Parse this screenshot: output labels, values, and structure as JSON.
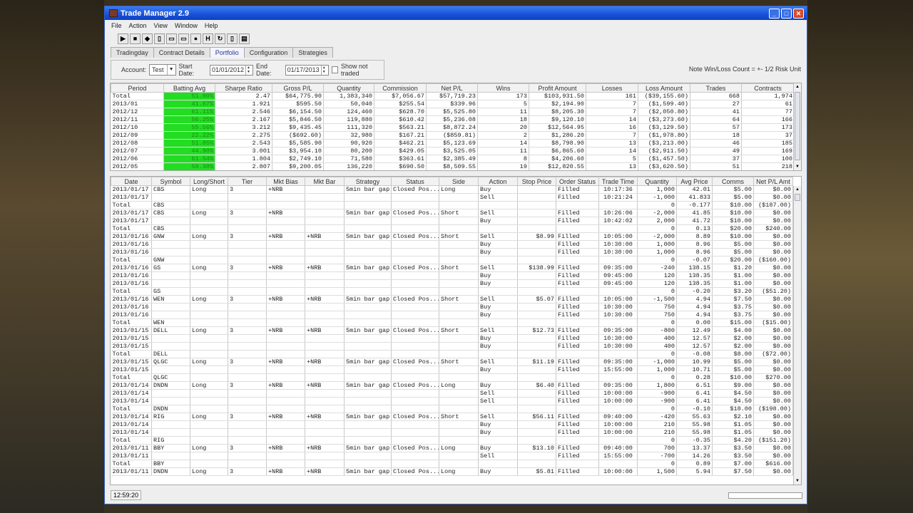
{
  "window": {
    "title": "Trade Manager 2.9"
  },
  "menu": [
    "File",
    "Action",
    "View",
    "Window",
    "Help"
  ],
  "toolbar": [
    {
      "icon": "open-icon",
      "glyph": "▶"
    },
    {
      "icon": "save-icon",
      "glyph": "■"
    },
    {
      "icon": "book-icon",
      "glyph": "◆"
    },
    {
      "icon": "doc-icon",
      "glyph": "▯"
    },
    {
      "icon": "copy-icon",
      "glyph": "▭"
    },
    {
      "icon": "paste-icon",
      "glyph": "▭"
    },
    {
      "icon": "stop-icon",
      "glyph": "●"
    },
    {
      "icon": "h-icon",
      "glyph": "H"
    },
    {
      "icon": "refresh-icon",
      "glyph": "↻"
    },
    {
      "icon": "clipboard-icon",
      "glyph": "▯"
    },
    {
      "icon": "report-icon",
      "glyph": "▤"
    }
  ],
  "tabs": [
    "Tradingday",
    "Contract Details",
    "Portfolio",
    "Configuration",
    "Strategies"
  ],
  "filter": {
    "account_label": "Account:",
    "account": "Test",
    "start_label": "Start Date:",
    "start": "01/01/2012",
    "end_label": "End Date:",
    "end": "01/17/2013",
    "show_not_traded": "Show not traded",
    "note": "Note Win/Loss Count = +- 1/2 Risk Unit"
  },
  "summary": {
    "columns": [
      "Period",
      "Batting Avg",
      "Sharpe Ratio",
      "Gross P/L",
      "Quantity",
      "Commission",
      "Net P/L",
      "Wins",
      "Profit Amount",
      "Losses",
      "Loss Amount",
      "Trades",
      "Contracts"
    ],
    "rows": [
      [
        "Total",
        "51.80%",
        "2.47",
        "$64,775.90",
        "1,383,340",
        "$7,056.67",
        "$57,719.23",
        "173",
        "$103,931.50",
        "161",
        "($39,155.60)",
        "668",
        "1,974"
      ],
      [
        "2013/01",
        "41.67%",
        "1.921",
        "$595.50",
        "50,040",
        "$255.54",
        "$339.96",
        "5",
        "$2,194.90",
        "7",
        "($1,599.40)",
        "27",
        "61"
      ],
      [
        "2012/12",
        "61.11%",
        "2.546",
        "$6,154.50",
        "124,460",
        "$628.70",
        "$5,525.80",
        "11",
        "$8,205.30",
        "7",
        "($2,050.80)",
        "41",
        "77"
      ],
      [
        "2012/11",
        "56.25%",
        "2.167",
        "$5,846.50",
        "119,880",
        "$610.42",
        "$5,236.08",
        "18",
        "$9,120.10",
        "14",
        "($3,273.60)",
        "64",
        "166"
      ],
      [
        "2012/10",
        "55.56%",
        "3.212",
        "$9,435.45",
        "111,320",
        "$563.21",
        "$8,872.24",
        "20",
        "$12,564.95",
        "16",
        "($3,129.50)",
        "57",
        "173"
      ],
      [
        "2012/09",
        "22.22%",
        "2.275",
        "($692.60)",
        "32,980",
        "$167.21",
        "($859.81)",
        "2",
        "$1,286.20",
        "7",
        "($1,978.80)",
        "18",
        "37"
      ],
      [
        "2012/08",
        "51.85%",
        "2.543",
        "$5,585.90",
        "90,920",
        "$462.21",
        "$5,123.69",
        "14",
        "$8,798.90",
        "13",
        "($3,213.00)",
        "46",
        "185"
      ],
      [
        "2012/07",
        "44.90%",
        "3.001",
        "$3,954.10",
        "80,200",
        "$429.05",
        "$3,525.05",
        "11",
        "$6,865.60",
        "14",
        "($2,911.50)",
        "49",
        "169"
      ],
      [
        "2012/06",
        "61.54%",
        "1.804",
        "$2,749.10",
        "71,580",
        "$363.61",
        "$2,385.49",
        "8",
        "$4,206.60",
        "5",
        "($1,457.50)",
        "37",
        "100"
      ],
      [
        "2012/05",
        "59.38%",
        "2.807",
        "$9,200.05",
        "136,220",
        "$690.50",
        "$8,509.55",
        "19",
        "$12,820.55",
        "13",
        "($3,620.50)",
        "51",
        "218"
      ]
    ]
  },
  "trades": {
    "columns": [
      "Date",
      "Symbol",
      "Long/Short",
      "Tier",
      "Mkt Bias",
      "Mkt Bar",
      "Strategy",
      "Status",
      "Side",
      "Action",
      "Stop Price",
      "Order Status",
      "Trade Time",
      "Quantity",
      "Avg Price",
      "Comms",
      "Net P/L Amt"
    ],
    "rows": [
      [
        "2013/01/17",
        "CBS",
        "Long",
        "3",
        "+NRB",
        "",
        "5min bar gap",
        "Closed Pos...",
        "Long",
        "Buy",
        "",
        "Filled",
        "10:17:36",
        "1,000",
        "42.01",
        "$5.00",
        "$0.00"
      ],
      [
        "2013/01/17",
        "",
        "",
        "",
        "",
        "",
        "",
        "",
        "",
        "Sell",
        "",
        "Filled",
        "10:21:24",
        "-1,000",
        "41.833",
        "$5.00",
        "$0.00"
      ],
      [
        "Total",
        "CBS",
        "",
        "",
        "",
        "",
        "",
        "",
        "",
        "",
        "",
        "",
        "",
        "0",
        "-0.177",
        "$10.00",
        "($187.00)"
      ],
      [
        "2013/01/17",
        "CBS",
        "Long",
        "3",
        "+NRB",
        "",
        "5min bar gap",
        "Closed Pos...",
        "Short",
        "Sell",
        "",
        "Filled",
        "10:26:06",
        "-2,000",
        "41.85",
        "$10.00",
        "$0.00"
      ],
      [
        "2013/01/17",
        "",
        "",
        "",
        "",
        "",
        "",
        "",
        "",
        "Buy",
        "",
        "Filled",
        "10:42:02",
        "2,000",
        "41.72",
        "$10.00",
        "$0.00"
      ],
      [
        "Total",
        "CBS",
        "",
        "",
        "",
        "",
        "",
        "",
        "",
        "",
        "",
        "",
        "",
        "0",
        "0.13",
        "$20.00",
        "$240.00"
      ],
      [
        "2013/01/16",
        "GNW",
        "Long",
        "3",
        "+NRB",
        "+NRB",
        "5min bar gap",
        "Closed Pos...",
        "Short",
        "Sell",
        "$8.99",
        "Filled",
        "10:05:00",
        "-2,000",
        "8.89",
        "$10.00",
        "$0.00"
      ],
      [
        "2013/01/16",
        "",
        "",
        "",
        "",
        "",
        "",
        "",
        "",
        "Buy",
        "",
        "Filled",
        "10:30:00",
        "1,000",
        "8.96",
        "$5.00",
        "$0.00"
      ],
      [
        "2013/01/16",
        "",
        "",
        "",
        "",
        "",
        "",
        "",
        "",
        "Buy",
        "",
        "Filled",
        "10:30:00",
        "1,000",
        "8.96",
        "$5.00",
        "$0.00"
      ],
      [
        "Total",
        "GNW",
        "",
        "",
        "",
        "",
        "",
        "",
        "",
        "",
        "",
        "",
        "",
        "0",
        "-0.07",
        "$20.00",
        "($160.00)"
      ],
      [
        "2013/01/16",
        "GS",
        "Long",
        "3",
        "+NRB",
        "+NRB",
        "5min bar gap",
        "Closed Pos...",
        "Short",
        "Sell",
        "$138.99",
        "Filled",
        "09:35:00",
        "-240",
        "138.15",
        "$1.20",
        "$0.00"
      ],
      [
        "2013/01/16",
        "",
        "",
        "",
        "",
        "",
        "",
        "",
        "",
        "Buy",
        "",
        "Filled",
        "09:45:00",
        "120",
        "138.35",
        "$1.00",
        "$0.00"
      ],
      [
        "2013/01/16",
        "",
        "",
        "",
        "",
        "",
        "",
        "",
        "",
        "Buy",
        "",
        "Filled",
        "09:45:00",
        "120",
        "138.35",
        "$1.00",
        "$0.00"
      ],
      [
        "Total",
        "GS",
        "",
        "",
        "",
        "",
        "",
        "",
        "",
        "",
        "",
        "",
        "",
        "0",
        "-0.20",
        "$3.20",
        "($51.20)"
      ],
      [
        "2013/01/16",
        "WEN",
        "Long",
        "3",
        "+NRB",
        "+NRB",
        "5min bar gap",
        "Closed Pos...",
        "Short",
        "Sell",
        "$5.07",
        "Filled",
        "10:05:00",
        "-1,500",
        "4.94",
        "$7.50",
        "$0.00"
      ],
      [
        "2013/01/16",
        "",
        "",
        "",
        "",
        "",
        "",
        "",
        "",
        "Buy",
        "",
        "Filled",
        "10:30:00",
        "750",
        "4.94",
        "$3.75",
        "$0.00"
      ],
      [
        "2013/01/16",
        "",
        "",
        "",
        "",
        "",
        "",
        "",
        "",
        "Buy",
        "",
        "Filled",
        "10:30:00",
        "750",
        "4.94",
        "$3.75",
        "$0.00"
      ],
      [
        "Total",
        "WEN",
        "",
        "",
        "",
        "",
        "",
        "",
        "",
        "",
        "",
        "",
        "",
        "0",
        "0.00",
        "$15.00",
        "($15.00)"
      ],
      [
        "2013/01/15",
        "DELL",
        "Long",
        "3",
        "+NRB",
        "+NRB",
        "5min bar gap",
        "Closed Pos...",
        "Short",
        "Sell",
        "$12.73",
        "Filled",
        "09:35:00",
        "-800",
        "12.49",
        "$4.00",
        "$0.00"
      ],
      [
        "2013/01/15",
        "",
        "",
        "",
        "",
        "",
        "",
        "",
        "",
        "Buy",
        "",
        "Filled",
        "10:30:00",
        "400",
        "12.57",
        "$2.00",
        "$0.00"
      ],
      [
        "2013/01/15",
        "",
        "",
        "",
        "",
        "",
        "",
        "",
        "",
        "Buy",
        "",
        "Filled",
        "10:30:00",
        "400",
        "12.57",
        "$2.00",
        "$0.00"
      ],
      [
        "Total",
        "DELL",
        "",
        "",
        "",
        "",
        "",
        "",
        "",
        "",
        "",
        "",
        "",
        "0",
        "-0.08",
        "$8.00",
        "($72.00)"
      ],
      [
        "2013/01/15",
        "QLGC",
        "Long",
        "3",
        "+NRB",
        "+NRB",
        "5min bar gap",
        "Closed Pos...",
        "Short",
        "Sell",
        "$11.19",
        "Filled",
        "09:35:00",
        "-1,000",
        "10.99",
        "$5.00",
        "$0.00"
      ],
      [
        "2013/01/15",
        "",
        "",
        "",
        "",
        "",
        "",
        "",
        "",
        "Buy",
        "",
        "Filled",
        "15:55:00",
        "1,000",
        "10.71",
        "$5.00",
        "$0.00"
      ],
      [
        "Total",
        "QLGC",
        "",
        "",
        "",
        "",
        "",
        "",
        "",
        "",
        "",
        "",
        "",
        "0",
        "0.28",
        "$10.00",
        "$270.00"
      ],
      [
        "2013/01/14",
        "DNDN",
        "Long",
        "3",
        "+NRB",
        "+NRB",
        "5min bar gap",
        "Closed Pos...",
        "Long",
        "Buy",
        "$6.40",
        "Filled",
        "09:35:00",
        "1,800",
        "6.51",
        "$9.00",
        "$0.00"
      ],
      [
        "2013/01/14",
        "",
        "",
        "",
        "",
        "",
        "",
        "",
        "",
        "Sell",
        "",
        "Filled",
        "10:00:00",
        "-900",
        "6.41",
        "$4.50",
        "$0.00"
      ],
      [
        "2013/01/14",
        "",
        "",
        "",
        "",
        "",
        "",
        "",
        "",
        "Sell",
        "",
        "Filled",
        "10:00:00",
        "-900",
        "6.41",
        "$4.50",
        "$0.00"
      ],
      [
        "Total",
        "DNDN",
        "",
        "",
        "",
        "",
        "",
        "",
        "",
        "",
        "",
        "",
        "",
        "0",
        "-0.10",
        "$18.00",
        "($198.00)"
      ],
      [
        "2013/01/14",
        "RIG",
        "Long",
        "3",
        "+NRB",
        "+NRB",
        "5min bar gap",
        "Closed Pos...",
        "Short",
        "Sell",
        "$56.11",
        "Filled",
        "09:40:00",
        "-420",
        "55.63",
        "$2.10",
        "$0.00"
      ],
      [
        "2013/01/14",
        "",
        "",
        "",
        "",
        "",
        "",
        "",
        "",
        "Buy",
        "",
        "Filled",
        "10:00:00",
        "210",
        "55.98",
        "$1.05",
        "$0.00"
      ],
      [
        "2013/01/14",
        "",
        "",
        "",
        "",
        "",
        "",
        "",
        "",
        "Buy",
        "",
        "Filled",
        "10:00:00",
        "210",
        "55.98",
        "$1.05",
        "$0.00"
      ],
      [
        "Total",
        "RIG",
        "",
        "",
        "",
        "",
        "",
        "",
        "",
        "",
        "",
        "",
        "",
        "0",
        "-0.35",
        "$4.20",
        "($151.20)"
      ],
      [
        "2013/01/11",
        "BBY",
        "Long",
        "3",
        "+NRB",
        "+NRB",
        "5min bar gap",
        "Closed Pos...",
        "Long",
        "Buy",
        "$13.10",
        "Filled",
        "09:40:00",
        "700",
        "13.37",
        "$3.50",
        "$0.00"
      ],
      [
        "2013/01/11",
        "",
        "",
        "",
        "",
        "",
        "",
        "",
        "",
        "Sell",
        "",
        "Filled",
        "15:55:00",
        "-700",
        "14.26",
        "$3.50",
        "$0.00"
      ],
      [
        "Total",
        "BBY",
        "",
        "",
        "",
        "",
        "",
        "",
        "",
        "",
        "",
        "",
        "",
        "0",
        "0.89",
        "$7.00",
        "$616.00"
      ],
      [
        "2013/01/11",
        "DNDN",
        "Long",
        "3",
        "+NRB",
        "+NRB",
        "5min bar gap",
        "Closed Pos...",
        "Long",
        "Buy",
        "$5.81",
        "Filled",
        "10:00:00",
        "1,500",
        "5.94",
        "$7.50",
        "$0.00"
      ]
    ]
  },
  "status": {
    "clock": "12:59:20"
  },
  "colors": {
    "batting_bg": "#22dd22",
    "title_bar": "#1850d8"
  }
}
